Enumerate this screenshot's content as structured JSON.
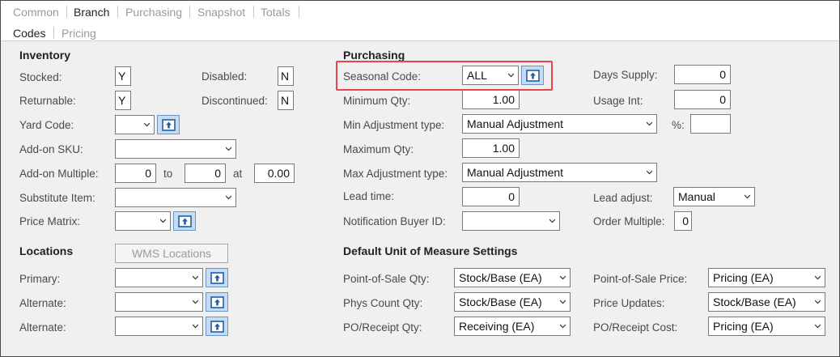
{
  "tabs_top": [
    {
      "label": "Common",
      "selected": false
    },
    {
      "label": "Branch",
      "selected": true
    },
    {
      "label": "Purchasing",
      "selected": false
    },
    {
      "label": "Snapshot",
      "selected": false
    },
    {
      "label": "Totals",
      "selected": false
    }
  ],
  "tabs_sub": [
    {
      "label": "Codes",
      "selected": true
    },
    {
      "label": "Pricing",
      "selected": false
    }
  ],
  "inventory": {
    "heading": "Inventory",
    "stocked_label": "Stocked:",
    "stocked_value": "Y",
    "disabled_label": "Disabled:",
    "disabled_value": "N",
    "returnable_label": "Returnable:",
    "returnable_value": "Y",
    "discontinued_label": "Discontinued:",
    "discontinued_value": "N",
    "yard_code_label": "Yard Code:",
    "yard_code_value": "",
    "addon_sku_label": "Add-on SKU:",
    "addon_sku_value": "",
    "addon_multiple_label": "Add-on Multiple:",
    "addon_multiple_from": "0",
    "to_label": "to",
    "addon_multiple_to": "0",
    "at_label": "at",
    "addon_multiple_at": "0.00",
    "substitute_label": "Substitute Item:",
    "substitute_value": "",
    "price_matrix_label": "Price Matrix:",
    "price_matrix_value": ""
  },
  "locations": {
    "heading": "Locations",
    "wms_button": "WMS Locations",
    "primary_label": "Primary:",
    "primary_value": "",
    "alternate1_label": "Alternate:",
    "alternate1_value": "",
    "alternate2_label": "Alternate:",
    "alternate2_value": ""
  },
  "purchasing": {
    "heading": "Purchasing",
    "seasonal_label": "Seasonal Code:",
    "seasonal_value": "ALL",
    "days_supply_label": "Days Supply:",
    "days_supply_value": "0",
    "min_qty_label": "Minimum Qty:",
    "min_qty_value": "1.00",
    "usage_int_label": "Usage Int:",
    "usage_int_value": "0",
    "min_adj_label": "Min Adjustment type:",
    "min_adj_value": "Manual Adjustment",
    "pct_label": "%:",
    "pct_value": "",
    "max_qty_label": "Maximum Qty:",
    "max_qty_value": "1.00",
    "max_adj_label": "Max Adjustment type:",
    "max_adj_value": "Manual Adjustment",
    "lead_time_label": "Lead time:",
    "lead_time_value": "0",
    "lead_adjust_label": "Lead adjust:",
    "lead_adjust_value": "Manual",
    "notif_label": "Notification Buyer ID:",
    "notif_value": "",
    "order_mult_label": "Order Multiple:",
    "order_mult_value": "0"
  },
  "uom": {
    "heading": "Default Unit of Measure Settings",
    "pos_qty_label": "Point-of-Sale Qty:",
    "pos_qty_value": "Stock/Base (EA)",
    "pos_price_label": "Point-of-Sale Price:",
    "pos_price_value": "Pricing (EA)",
    "phys_count_label": "Phys Count Qty:",
    "phys_count_value": "Stock/Base (EA)",
    "price_updates_label": "Price Updates:",
    "price_updates_value": "Stock/Base (EA)",
    "po_qty_label": "PO/Receipt Qty:",
    "po_qty_value": "Receiving (EA)",
    "po_cost_label": "PO/Receipt Cost:",
    "po_cost_value": "Pricing (EA)"
  },
  "colors": {
    "highlight": "#e8464a",
    "icon_button_bg": "#c5dcf2",
    "icon_arrow": "#1f5fa8"
  },
  "icons": {
    "dropdown": "chevron-down-icon",
    "lookup": "lookup-arrow-icon"
  }
}
